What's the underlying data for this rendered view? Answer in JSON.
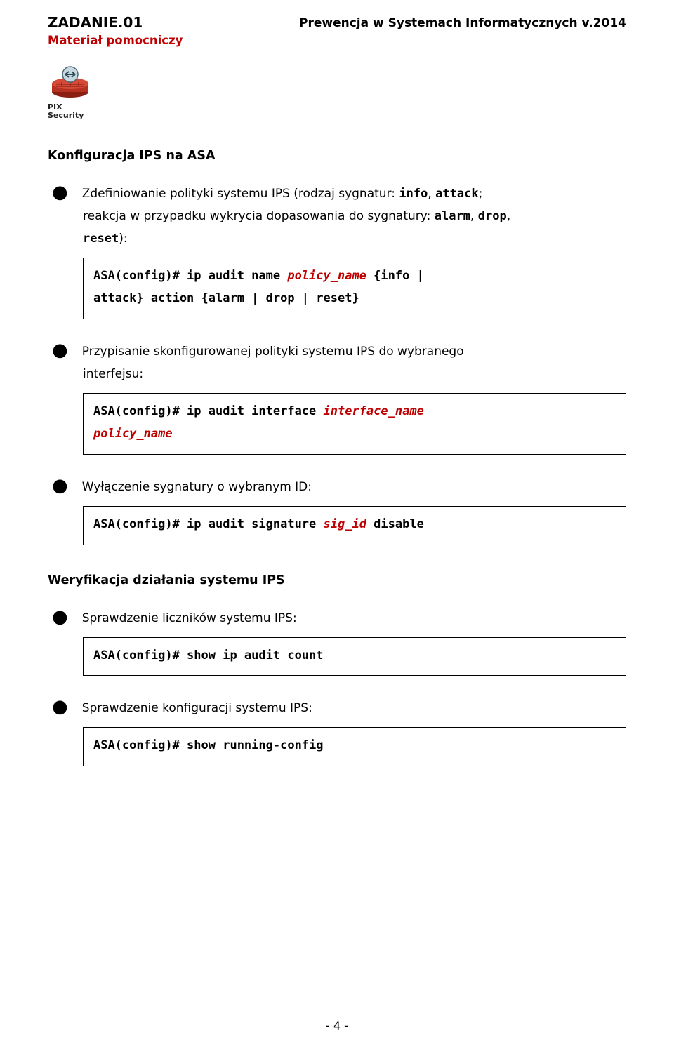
{
  "header": {
    "left": "ZADANIE.01",
    "right": "Prewencja w Systemach Informatycznych v.2014",
    "subtitle": "Materiał pomocniczy"
  },
  "pix": {
    "line1": "PIX",
    "line2": "Security"
  },
  "section_title": "Konfiguracja IPS na ASA",
  "b1": {
    "t1": "Zdefiniowanie polityki systemu IPS (rodzaj sygnatur: ",
    "m1": "info",
    "t2": ", ",
    "m2": "attack",
    "t3": ";",
    "line2a": "reakcja w przypadku wykrycia dopasowania do sygnatury: ",
    "m3": "alarm",
    "line2b": ", ",
    "m4": "drop",
    "line2c": ",",
    "m5": "reset",
    "line3b": "):"
  },
  "code1": {
    "l1a": "ASA(config)# ip audit name ",
    "l1b": "policy_name",
    "l1c": " {info |",
    "l2": "attack} action {alarm | drop | reset}"
  },
  "b2": {
    "t1": "Przypisanie skonfigurowanej polityki systemu IPS do wybranego",
    "t2": "interfejsu:"
  },
  "code2": {
    "l1a": "ASA(config)# ip audit interface ",
    "l1b": "interface_name",
    "l2": "policy_name"
  },
  "b3": {
    "t1": "Wyłączenie sygnatury o wybranym ID:"
  },
  "code3": {
    "l1a": "ASA(config)# ip audit signature ",
    "l1b": "sig_id",
    "l1c": " disable"
  },
  "verify_title": "Weryfikacja działania systemu IPS",
  "b4": {
    "t1": "Sprawdzenie liczników systemu IPS:"
  },
  "code4": {
    "l1": "ASA(config)# show ip audit count"
  },
  "b5": {
    "t1": "Sprawdzenie konfiguracji systemu IPS:"
  },
  "code5": {
    "l1": "ASA(config)# show running-config"
  },
  "page": "- 4 -"
}
